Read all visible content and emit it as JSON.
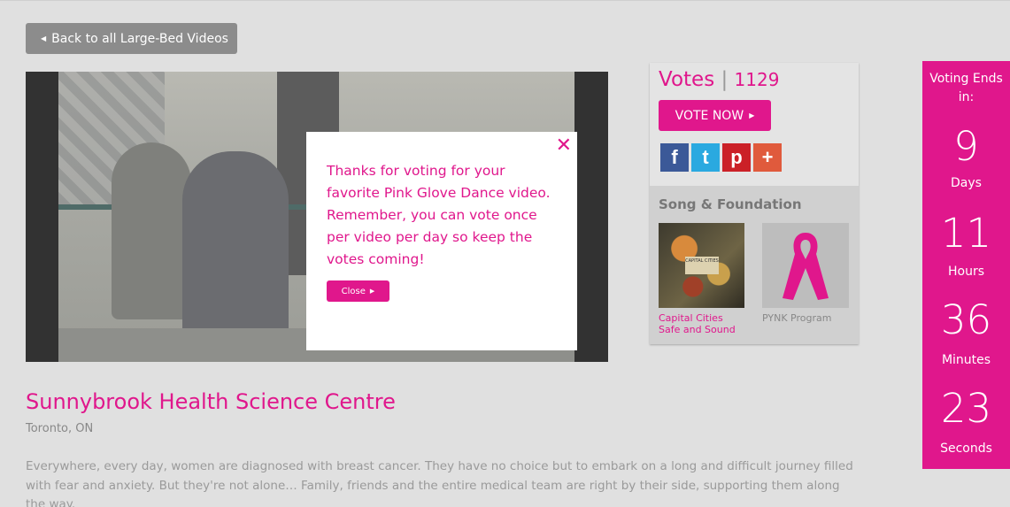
{
  "nav": {
    "back_label": "Back to all Large-Bed Videos"
  },
  "popup": {
    "message": "Thanks for voting for your favorite Pink Glove Dance video. Remember, you can vote once per video per day so keep the votes coming!",
    "close_label": "Close"
  },
  "votes": {
    "label": "Votes",
    "count": "1129",
    "vote_button": "VOTE NOW"
  },
  "social": [
    {
      "name": "facebook",
      "glyph": "f",
      "color": "#3b5998"
    },
    {
      "name": "twitter",
      "glyph": "t",
      "color": "#2aa9e0"
    },
    {
      "name": "pinterest",
      "glyph": "p",
      "color": "#cb2027"
    },
    {
      "name": "more",
      "glyph": "+",
      "color": "#e05a3c"
    }
  ],
  "song_foundation": {
    "title": "Song & Foundation",
    "song_artist": "Capital Cities",
    "song_title": "Safe and Sound",
    "foundation": "PYNK Program"
  },
  "countdown": {
    "heading": "Voting Ends in:",
    "days": "9",
    "days_label": "Days",
    "hours": "11",
    "hours_label": "Hours",
    "minutes": "36",
    "minutes_label": "Minutes",
    "seconds": "23",
    "seconds_label": "Seconds"
  },
  "entry": {
    "organization": "Sunnybrook Health Science Centre",
    "location": "Toronto, ON",
    "description": "Everywhere, every day, women are diagnosed with breast cancer.   They have no choice but to embark on a long and difficult journey filled with fear and anxiety.  But they're not alone… Family, friends and the entire medical team are right by their side, supporting them along the way."
  },
  "colors": {
    "accent": "#e0178c",
    "background": "#e0e0e0",
    "back_button": "#8c8c8c"
  }
}
